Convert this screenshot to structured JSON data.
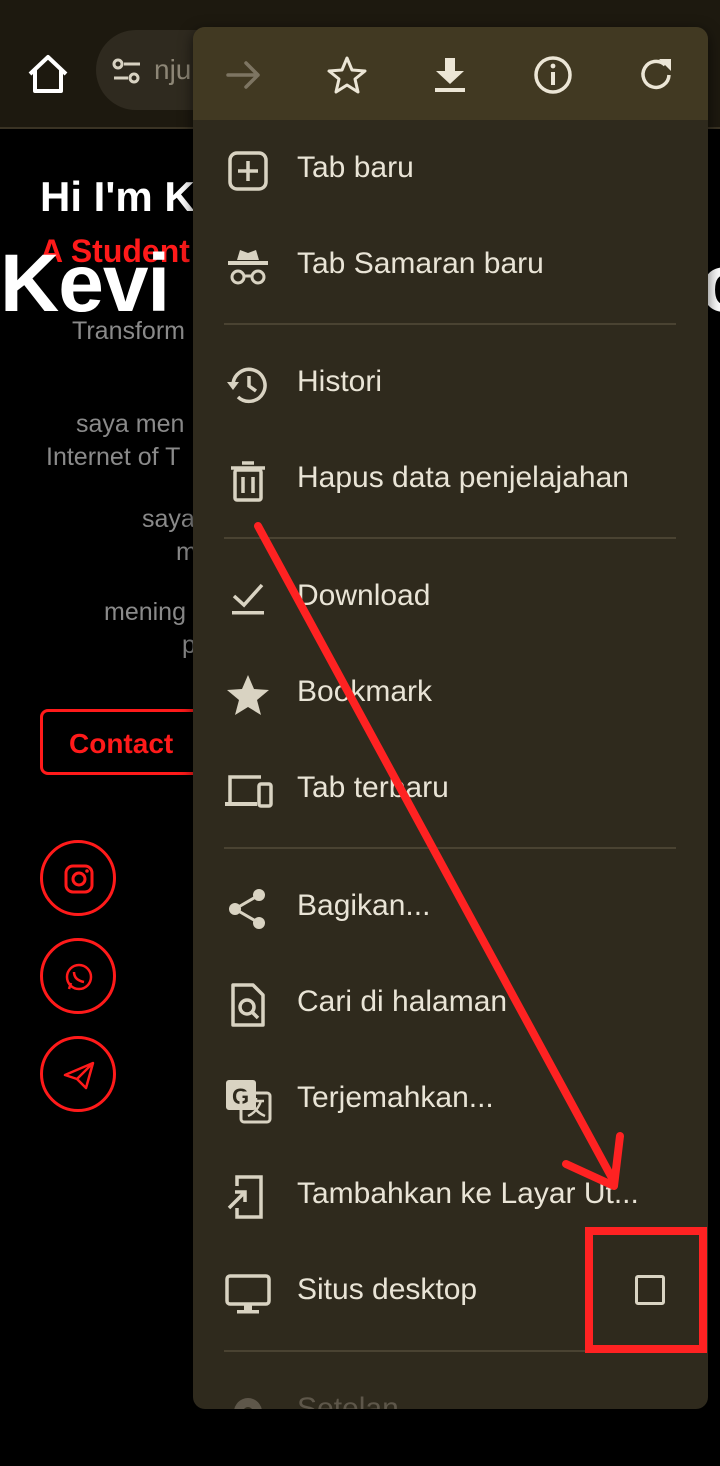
{
  "browser": {
    "url_fragment": "nju"
  },
  "website": {
    "greeting": "Hi I'm K",
    "subtitle": "A Student",
    "big_name": "Kevi",
    "big_name_tail": "o",
    "paragraph_lines": [
      "Transform",
      "saya men",
      "Internet of T",
      "saya",
      "m",
      "mening",
      "p"
    ],
    "contact_label": "Contact"
  },
  "menu": {
    "toolbar": [
      "forward-icon",
      "star-icon",
      "download-icon",
      "info-icon",
      "refresh-icon"
    ],
    "items": [
      {
        "label": "Tab baru",
        "icon": "new-tab-icon"
      },
      {
        "label": "Tab Samaran baru",
        "icon": "incognito-icon"
      },
      {
        "label": "Histori",
        "icon": "history-icon"
      },
      {
        "label": "Hapus data penjelajahan",
        "icon": "trash-icon"
      },
      {
        "label": "Download",
        "icon": "downloads-check-icon"
      },
      {
        "label": "Bookmark",
        "icon": "bookmark-star-icon"
      },
      {
        "label": "Tab terbaru",
        "icon": "devices-icon"
      },
      {
        "label": "Bagikan...",
        "icon": "share-icon"
      },
      {
        "label": "Cari di halaman",
        "icon": "find-in-page-icon"
      },
      {
        "label": "Terjemahkan...",
        "icon": "translate-icon"
      },
      {
        "label": "Tambahkan ke Layar Ut...",
        "icon": "add-to-home-icon"
      },
      {
        "label": "Situs desktop",
        "icon": "desktop-icon",
        "checked": false
      },
      {
        "label": "Setelan",
        "icon": "settings-icon"
      }
    ]
  },
  "annotation": {
    "color": "#ff2222"
  }
}
